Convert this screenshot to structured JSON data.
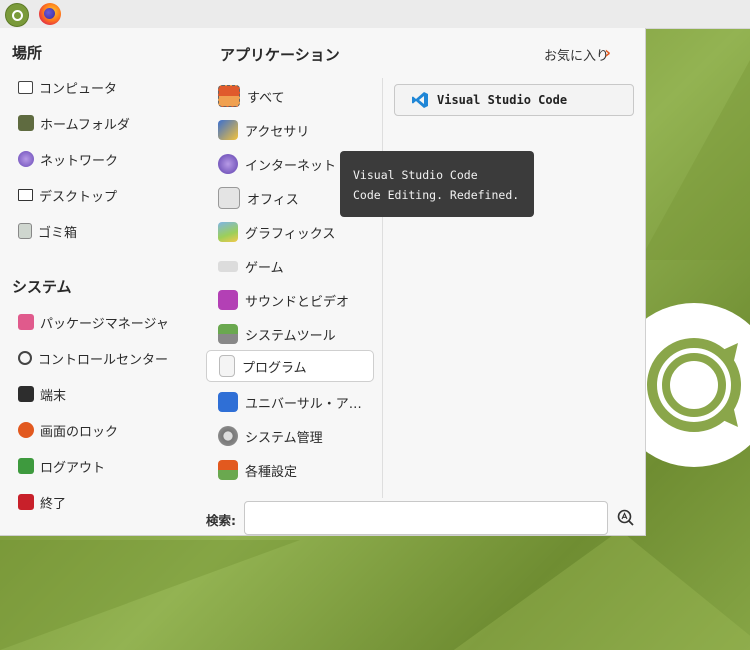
{
  "menu": {
    "places_heading": "場所",
    "places": [
      "コンピュータ",
      "ホームフォルダ",
      "ネットワーク",
      "デスクトップ",
      "ゴミ箱"
    ],
    "system_heading": "システム",
    "system": [
      "パッケージマネージャ",
      "コントロールセンター",
      "端末",
      "画面のロック",
      "ログアウト",
      "終了"
    ],
    "apps_heading": "アプリケーション",
    "favorites_label": "お気に入り",
    "categories": [
      "すべて",
      "アクセサリ",
      "インターネット",
      "オフィス",
      "グラフィックス",
      "ゲーム",
      "サウンドとビデオ",
      "システムツール",
      "プログラム",
      "ユニバーサル・ア…",
      "システム管理",
      "各種設定"
    ],
    "selected_category": "プログラム",
    "app": "Visual Studio Code",
    "tooltip_line1": "Visual Studio Code",
    "tooltip_line2": "Code Editing. Redefined.",
    "search_label": "検索:",
    "search_value": ""
  },
  "colors": {
    "accent": "#e2591f",
    "desktop": "#86a545",
    "tooltip": "#3b3b3b",
    "vscode_blue": "#1f86d6"
  }
}
